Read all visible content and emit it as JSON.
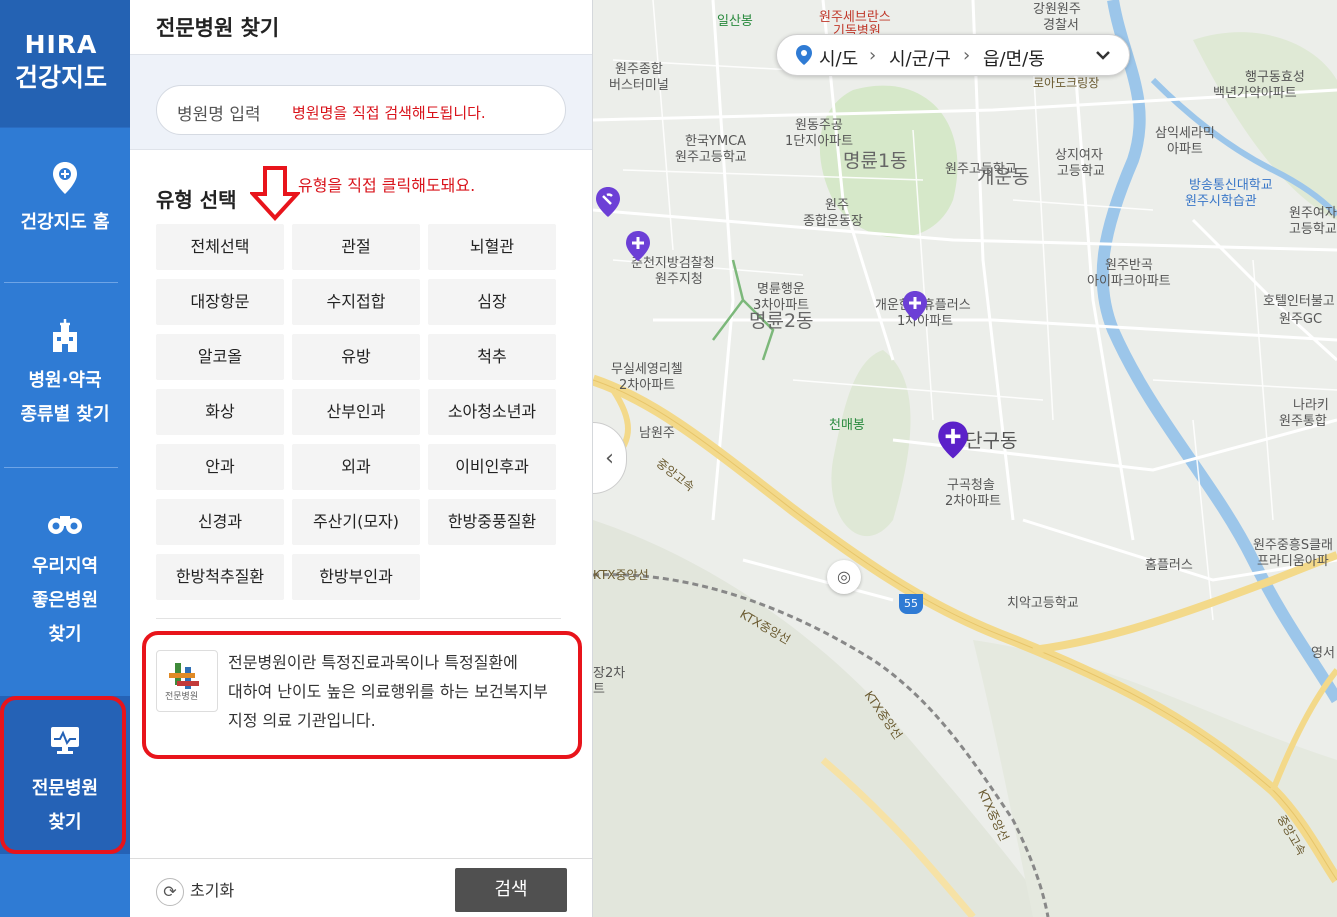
{
  "nav": {
    "logo_line1": "HIRA",
    "logo_line2": "건강지도",
    "items": [
      {
        "label_1": "건강지도 홈"
      },
      {
        "label_1": "병원·약국",
        "label_2": "종류별 찾기"
      },
      {
        "label_1": "우리지역",
        "label_2": "좋은병원",
        "label_3": "찾기"
      },
      {
        "label_1": "전문병원",
        "label_2": "찾기"
      }
    ],
    "active_index": 3,
    "colors": {
      "nav_bg": "#2f7bd4",
      "logo_bg": "#2462b3",
      "active_bg": "#2562b6",
      "highlight": "#e8141b"
    }
  },
  "panel": {
    "title": "전문병원 찾기",
    "search": {
      "placeholder": "병원명 입력",
      "annotation": "병원명을 직접 검색해도됩니다."
    },
    "type_section": {
      "label": "유형 선택",
      "annotation": "유형을 직접 클릭해도돼요.",
      "types": [
        "전체선택",
        "관절",
        "뇌혈관",
        "대장항문",
        "수지접합",
        "심장",
        "알코올",
        "유방",
        "척추",
        "화상",
        "산부인과",
        "소아청소년과",
        "안과",
        "외과",
        "이비인후과",
        "신경과",
        "주산기(모자)",
        "한방중풍질환",
        "한방척추질환",
        "한방부인과"
      ]
    },
    "info": {
      "logo_text": "전문병원",
      "line_1": "전문병원이란 특정진료과목이나 특정질환에",
      "line_2": "대하여 난이도 높은 의료행위를 하는 보건복지부",
      "line_3": "지정 의료 기관입니다."
    },
    "footer": {
      "reset_label": "초기화",
      "search_label": "검색"
    }
  },
  "map": {
    "region_select": {
      "sido": "시/도",
      "sigungu": "시/군/구",
      "eupmyeondong": "읍/면/동"
    },
    "labels": [
      {
        "name": "일산봉",
        "cls": "green"
      },
      {
        "name": "원주세브란스"
      },
      {
        "name": "기독병원"
      },
      {
        "name": "강원원주"
      },
      {
        "name": "경찰서"
      },
      {
        "name": "원주종합"
      },
      {
        "name": "버스터미널"
      },
      {
        "name": "행구동효성"
      },
      {
        "name": "백년가약아파트"
      },
      {
        "name": "로아도크링장"
      },
      {
        "name": "원동주공"
      },
      {
        "name": "1단지아파트"
      },
      {
        "name": "명륜1동",
        "cls": "big"
      },
      {
        "name": "한국YMCA"
      },
      {
        "name": "원주고등학교"
      },
      {
        "name": "원주고등학교"
      },
      {
        "name": "개운동",
        "cls": "big"
      },
      {
        "name": "상지여자"
      },
      {
        "name": "고등학교"
      },
      {
        "name": "삼익세라믹"
      },
      {
        "name": "아파트"
      },
      {
        "name": "원주"
      },
      {
        "name": "종합운동장"
      },
      {
        "name": "방송통신대학교"
      },
      {
        "name": "원주시학습관"
      },
      {
        "name": "원주여자"
      },
      {
        "name": "고등학교"
      },
      {
        "name": "춘천지방검찰청"
      },
      {
        "name": "원주지청"
      },
      {
        "name": "원주반곡"
      },
      {
        "name": "아이파크아파트"
      },
      {
        "name": "명륜행운"
      },
      {
        "name": "3차아파트"
      },
      {
        "name": "명륜2동",
        "cls": "big"
      },
      {
        "name": "개운한신휴플러스"
      },
      {
        "name": "1차아파트"
      },
      {
        "name": "호텔인터불고"
      },
      {
        "name": "원주GC"
      },
      {
        "name": "무실세영리첼"
      },
      {
        "name": "2차아파트"
      },
      {
        "name": "천매봉",
        "cls": "green"
      },
      {
        "name": "남원주"
      },
      {
        "name": "단구동",
        "cls": "big"
      },
      {
        "name": "나라키"
      },
      {
        "name": "원주통합"
      },
      {
        "name": "중앙고속",
        "cls": "road"
      },
      {
        "name": "구곡청솔"
      },
      {
        "name": "2차아파트"
      },
      {
        "name": "원주중흥S클래"
      },
      {
        "name": "프라디움아파"
      },
      {
        "name": "홈플러스"
      },
      {
        "name": "KTX중앙선"
      },
      {
        "name": "55"
      },
      {
        "name": "치악고등학교"
      },
      {
        "name": "KTX중앙선"
      },
      {
        "name": "장2차"
      },
      {
        "name": "트"
      },
      {
        "name": "영서"
      },
      {
        "name": "KTX중앙선"
      },
      {
        "name": "KTX중앙선"
      },
      {
        "name": "중앙고속",
        "cls": "road"
      }
    ],
    "colors": {
      "land": "#eceeea",
      "road_major": "#f3d98a",
      "river": "#9cc6ea",
      "park": "#d6e8c9",
      "pin": "#6c3fd6"
    }
  }
}
